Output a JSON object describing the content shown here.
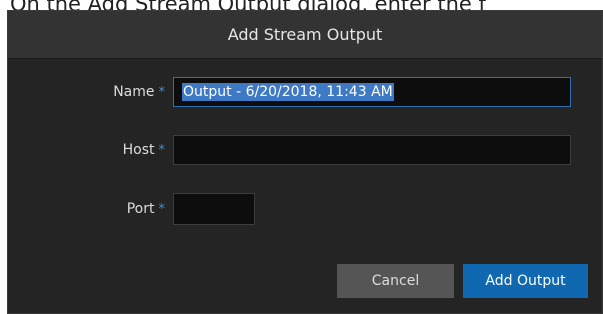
{
  "document": {
    "context_text": "On the Add Stream Output dialog, enter the f"
  },
  "dialog": {
    "title": "Add Stream Output",
    "fields": {
      "name": {
        "label": "Name",
        "required_marker": "*",
        "value": "Output - 6/20/2018, 11:43 AM"
      },
      "host": {
        "label": "Host",
        "required_marker": "*",
        "value": ""
      },
      "port": {
        "label": "Port",
        "required_marker": "*",
        "value": ""
      }
    },
    "buttons": {
      "cancel": "Cancel",
      "submit": "Add Output"
    }
  },
  "colors": {
    "background": "#242424",
    "header": "#333333",
    "accent": "#0f68b0",
    "required": "#3c8fd6",
    "selection": "#3d79c4"
  }
}
